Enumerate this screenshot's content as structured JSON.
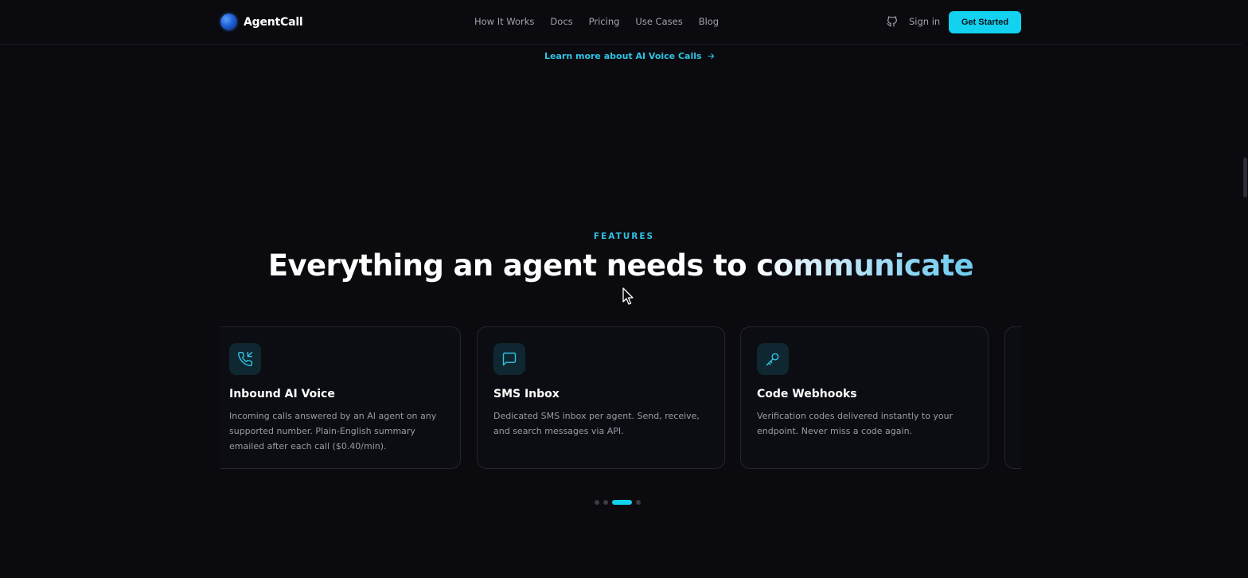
{
  "header": {
    "logo_text": "AgentCall",
    "nav": [
      "How It Works",
      "Docs",
      "Pricing",
      "Use Cases",
      "Blog"
    ],
    "github_icon": "github-icon",
    "signin_label": "Sign in",
    "cta_label": "Get Started"
  },
  "learn_more": {
    "label": "Learn more about AI Voice Calls",
    "icon": "arrow-right-icon"
  },
  "features": {
    "eyebrow": "FEATURES",
    "headline_plain": "Everything an agent needs to ",
    "headline_gradient": "communicate",
    "cards": [
      {
        "icon": "phone-incoming-icon",
        "title": "Inbound AI Voice",
        "description": "Incoming calls answered by an AI agent on any supported number. Plain-English summary emailed after each call ($0.40/min)."
      },
      {
        "icon": "message-square-icon",
        "title": "SMS Inbox",
        "description": "Dedicated SMS inbox per agent. Send, receive, and search messages via API."
      },
      {
        "icon": "key-icon",
        "title": "Code Webhooks",
        "description": "Verification codes delivered instantly to your endpoint. Never miss a code again."
      }
    ],
    "carousel_page": 3,
    "carousel_pages": 4
  },
  "colors": {
    "accent": "#12d2f0",
    "background": "#0a0a0f",
    "card_border": "#24252d"
  }
}
